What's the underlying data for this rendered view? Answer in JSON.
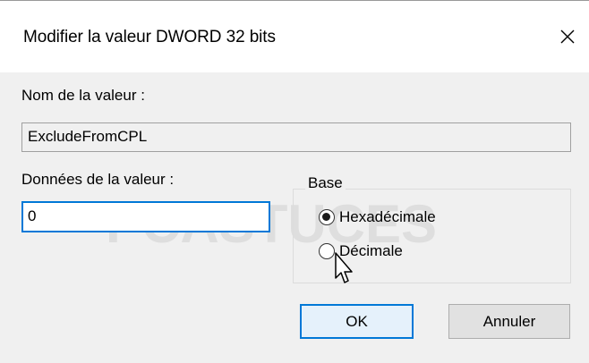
{
  "dialog": {
    "title": "Modifier la valeur DWORD 32 bits",
    "close_icon": "close-icon"
  },
  "fields": {
    "name_label": "Nom de la valeur :",
    "name_value": "ExcludeFromCPL",
    "data_label": "Données de la valeur :",
    "data_value": "0"
  },
  "base": {
    "legend": "Base",
    "options": [
      {
        "label": "Hexadécimale",
        "checked": true
      },
      {
        "label": "Décimale",
        "checked": false
      }
    ]
  },
  "buttons": {
    "ok_label": "OK",
    "cancel_label": "Annuler"
  },
  "watermark": {
    "text": "PCASTUCES"
  },
  "colors": {
    "accent": "#0078d7",
    "dialog_bg": "#f0f0f0",
    "title_bg": "#ffffff"
  }
}
